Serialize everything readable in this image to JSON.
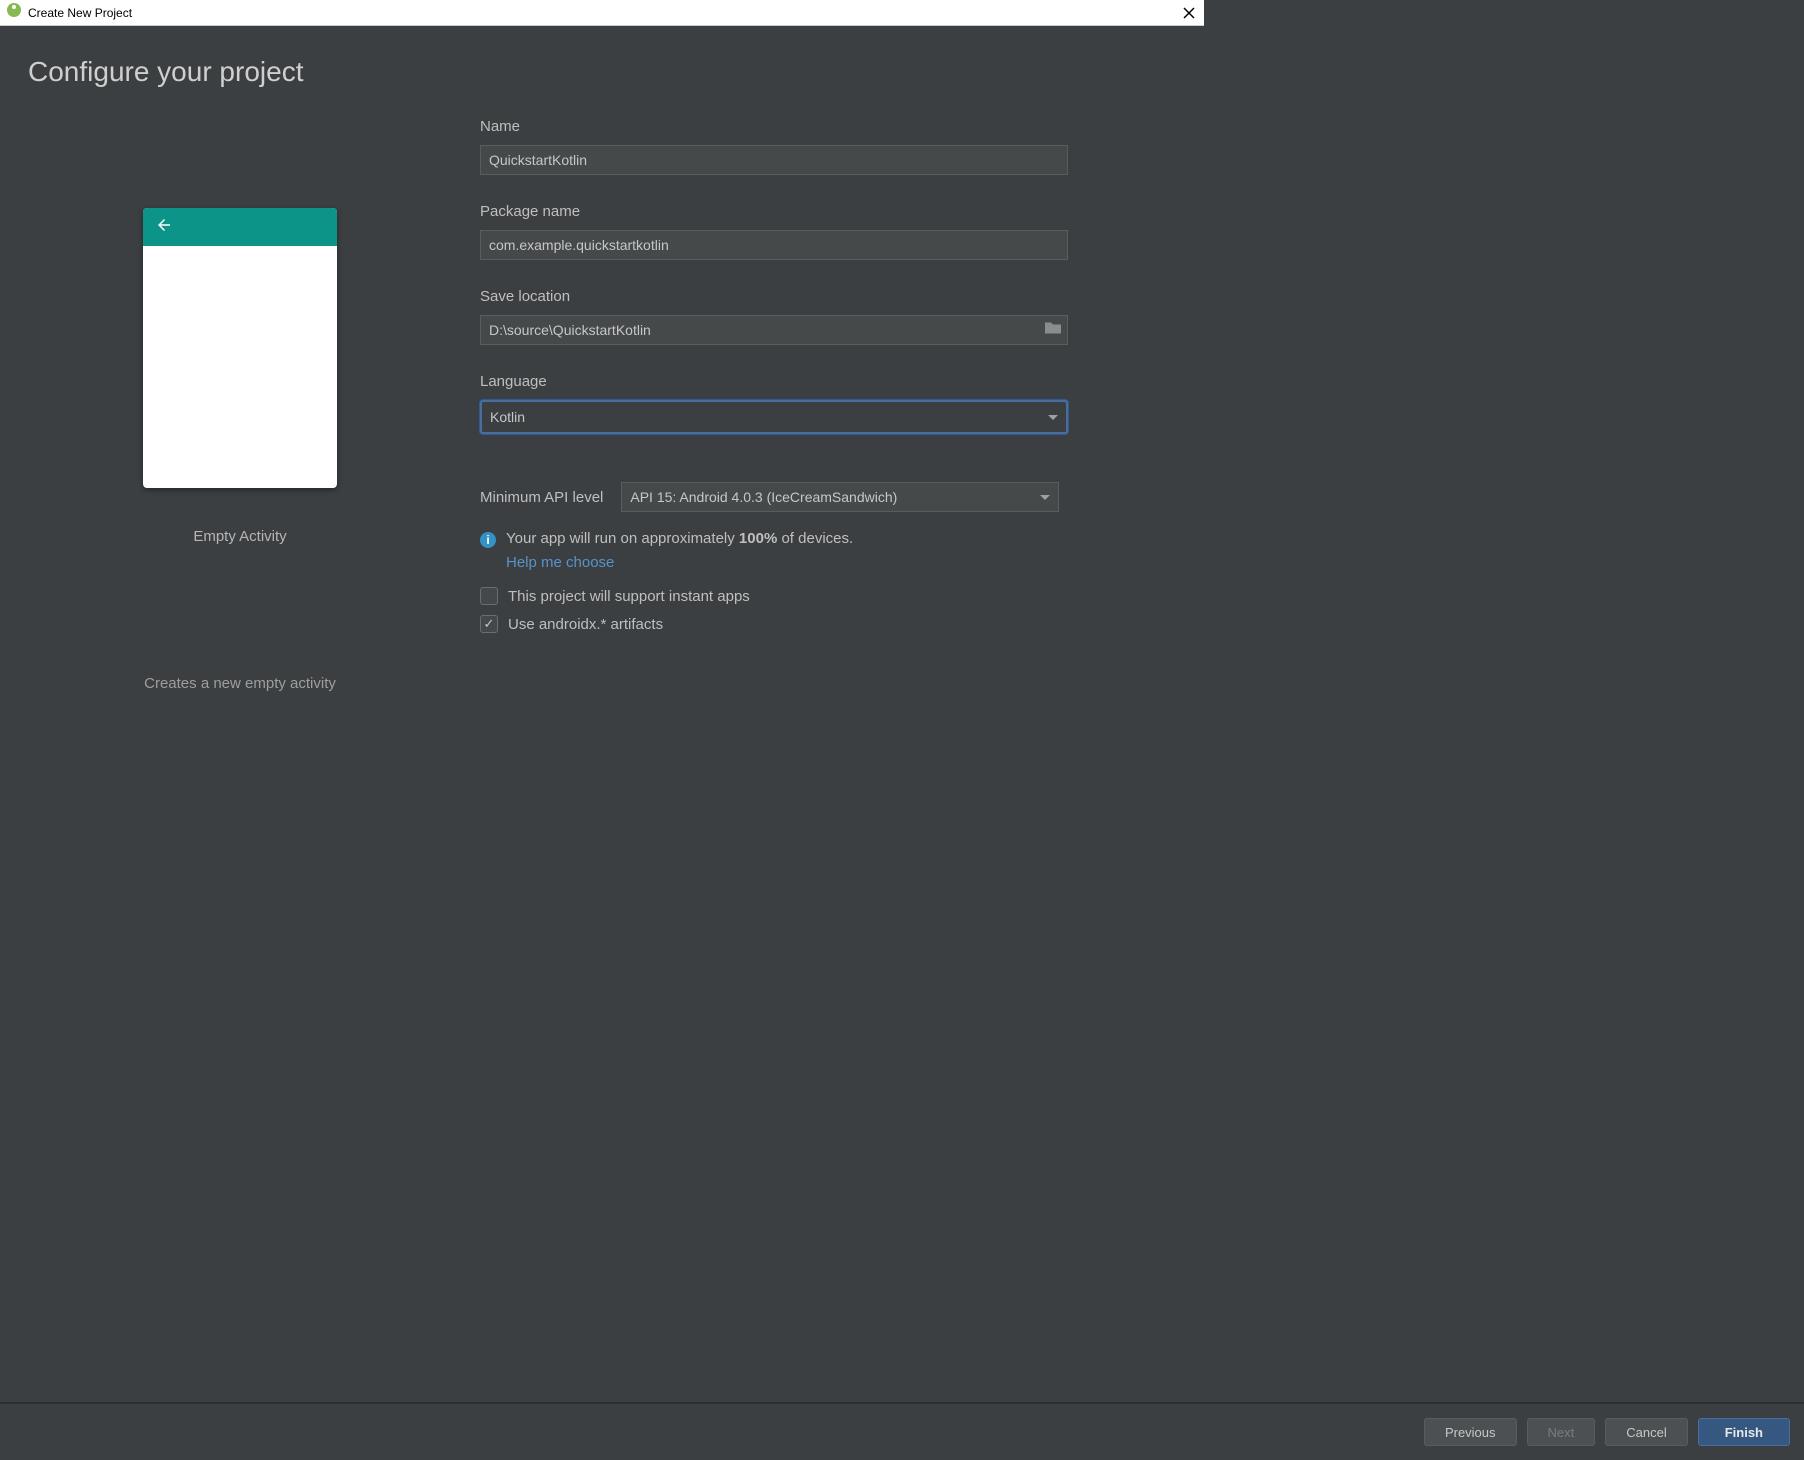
{
  "titlebar": {
    "title": "Create New Project"
  },
  "header": {
    "title": "Configure your project"
  },
  "preview": {
    "label": "Empty Activity",
    "description": "Creates a new empty activity"
  },
  "form": {
    "name_label": "Name",
    "name_value": "QuickstartKotlin",
    "package_label": "Package name",
    "package_value": "com.example.quickstartkotlin",
    "location_label": "Save location",
    "location_value": "D:\\source\\QuickstartKotlin",
    "language_label": "Language",
    "language_value": "Kotlin",
    "api_label": "Minimum API level",
    "api_value": "API 15: Android 4.0.3 (IceCreamSandwich)",
    "info_prefix": "Your app will run on approximately ",
    "info_percent": "100%",
    "info_suffix": " of devices.",
    "help_link": "Help me choose",
    "instant_apps_label": "This project will support instant apps",
    "instant_apps_checked": false,
    "androidx_label": "Use androidx.* artifacts",
    "androidx_checked": true
  },
  "footer": {
    "previous": "Previous",
    "next": "Next",
    "cancel": "Cancel",
    "finish": "Finish"
  }
}
